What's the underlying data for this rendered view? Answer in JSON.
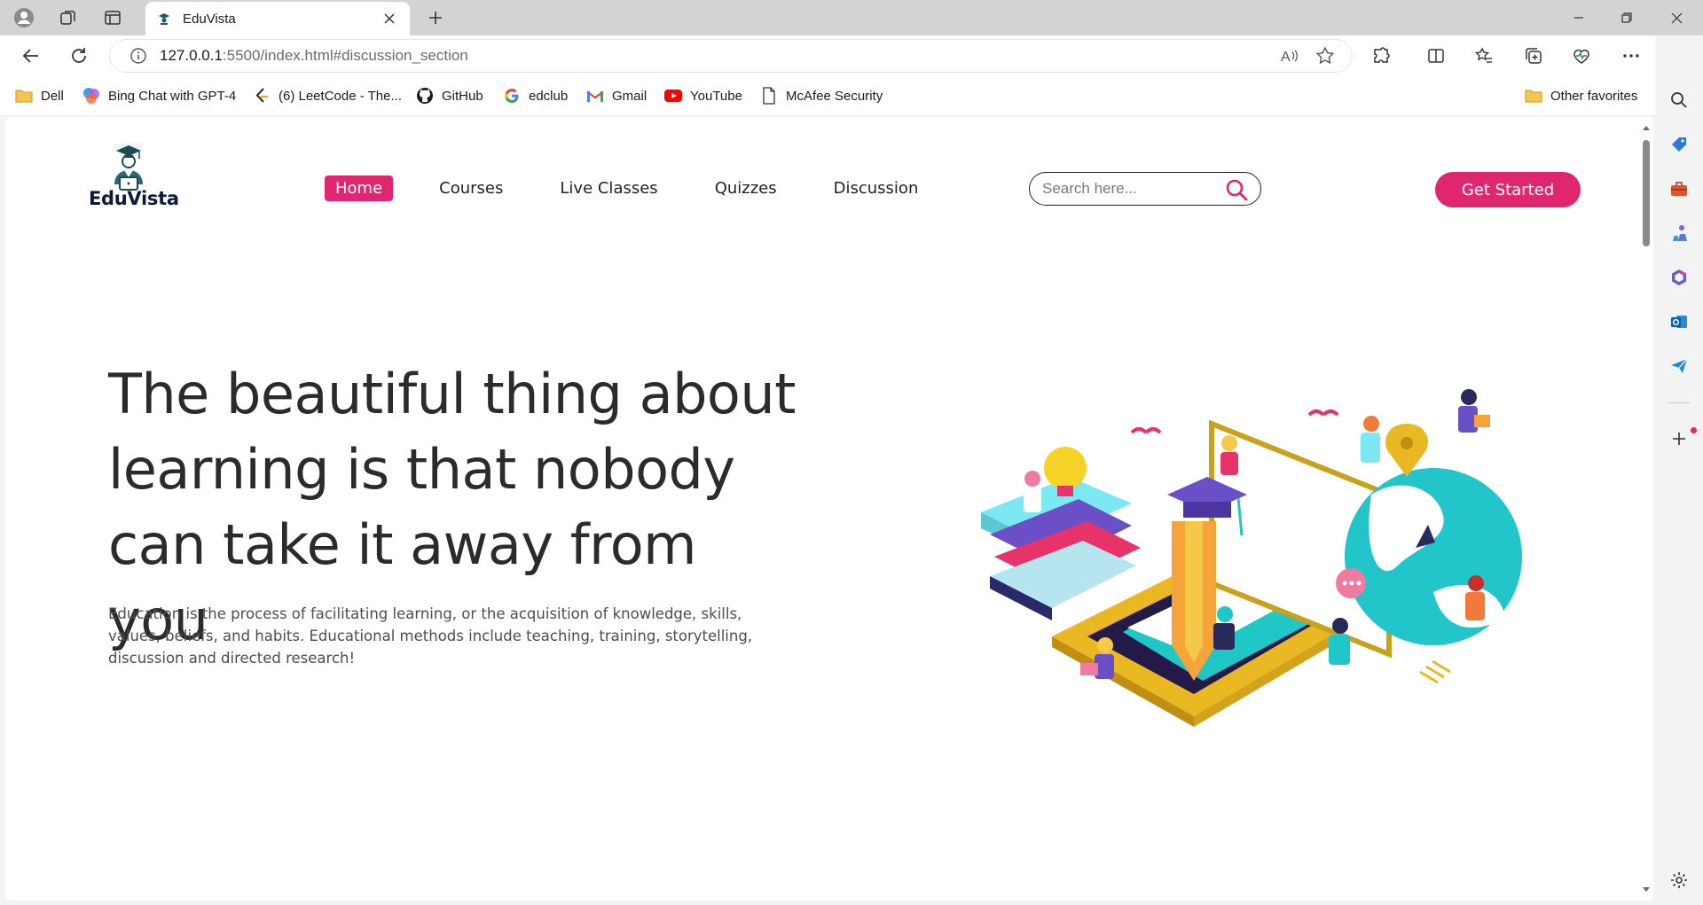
{
  "browser": {
    "tab_title": "EduVista",
    "url_host": "127.0.0.1",
    "url_rest": ":5500/index.html#discussion_section"
  },
  "favorites": {
    "items": [
      {
        "label": "Dell",
        "icon": "folder-icon"
      },
      {
        "label": "Bing Chat with GPT-4",
        "icon": "copilot-icon"
      },
      {
        "label": "(6) LeetCode - The...",
        "icon": "leetcode-icon"
      },
      {
        "label": "GitHub",
        "icon": "github-icon"
      },
      {
        "label": "edclub",
        "icon": "google-icon"
      },
      {
        "label": "Gmail",
        "icon": "gmail-icon"
      },
      {
        "label": "YouTube",
        "icon": "youtube-icon"
      },
      {
        "label": "McAfee Security",
        "icon": "page-icon"
      }
    ],
    "other": "Other favorites"
  },
  "site": {
    "brand": "EduVista",
    "nav": [
      "Home",
      "Courses",
      "Live Classes",
      "Quizzes",
      "Discussion"
    ],
    "search_placeholder": "Search here...",
    "cta": "Get Started",
    "accent": "#e0266f"
  },
  "hero": {
    "title_lines": [
      "The beautiful thing about",
      "learning is that nobody",
      "can take it away from you"
    ],
    "description": "Education is the process of facilitating learning, or the acquisition of knowledge, skills, values, beliefs, and habits. Educational methods include teaching, training, storytelling, discussion and directed research!"
  }
}
